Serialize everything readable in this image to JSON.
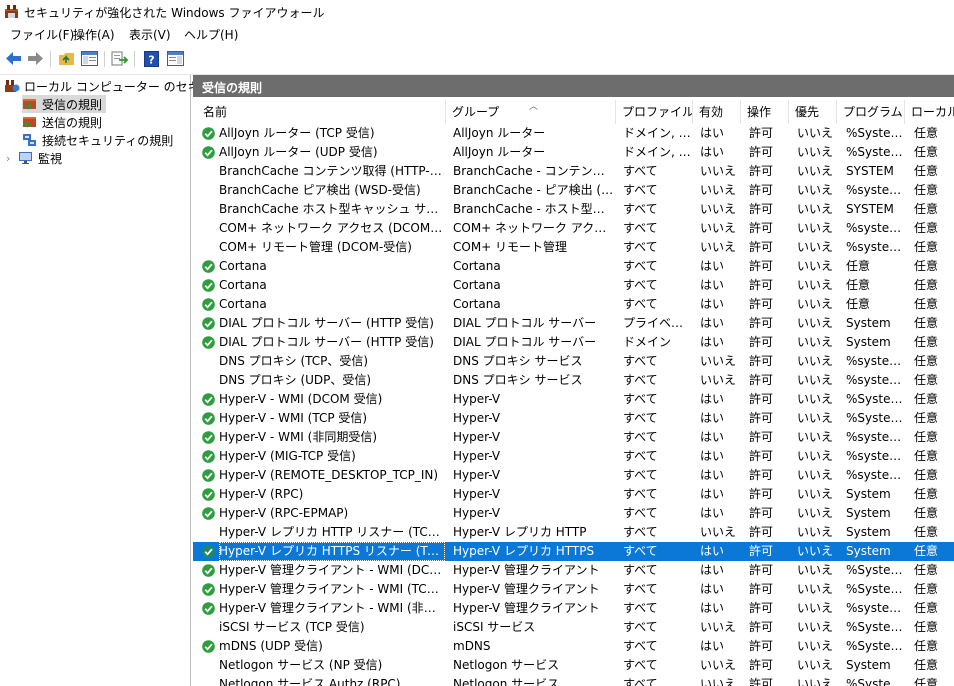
{
  "window": {
    "title": "セキュリティが強化された Windows ファイアウォール"
  },
  "menu": [
    "ファイル(F)",
    "操作(A)",
    "表示(V)",
    "ヘルプ(H)"
  ],
  "toolbar": {
    "buttons": [
      "back-icon",
      "forward-icon",
      "up-folder-icon",
      "show-hide-tree-icon",
      "export-list-icon",
      "help-icon",
      "show-hide-action-pane-icon"
    ]
  },
  "tree": {
    "root": "ローカル コンピューター のセキュリティ",
    "items": [
      "受信の規則",
      "送信の規則",
      "接続セキュリティの規則",
      "監視"
    ]
  },
  "panel": {
    "title": "受信の規則"
  },
  "columns": [
    "名前",
    "グループ",
    "プロファイル",
    "有効",
    "操作",
    "優先",
    "プログラム",
    "ローカル"
  ],
  "rules": [
    {
      "name": "AllJoyn ルーター (TCP 受信)",
      "group": "AllJoyn ルーター",
      "profile": "ドメイン, プ...",
      "enabled": "はい",
      "action": "許可",
      "override": "いいえ",
      "program": "%System...",
      "local": "任意",
      "on": true
    },
    {
      "name": "AllJoyn ルーター (UDP 受信)",
      "group": "AllJoyn ルーター",
      "profile": "ドメイン, プ...",
      "enabled": "はい",
      "action": "許可",
      "override": "いいえ",
      "program": "%System...",
      "local": "任意",
      "on": true
    },
    {
      "name": "BranchCache コンテンツ取得 (HTTP-受信)",
      "group": "BranchCache - コンテンツ取得...",
      "profile": "すべて",
      "enabled": "いいえ",
      "action": "許可",
      "override": "いいえ",
      "program": "SYSTEM",
      "local": "任意",
      "on": false
    },
    {
      "name": "BranchCache ピア検出 (WSD-受信)",
      "group": "BranchCache - ピア検出 (WS...",
      "profile": "すべて",
      "enabled": "いいえ",
      "action": "許可",
      "override": "いいえ",
      "program": "%system...",
      "local": "任意",
      "on": false
    },
    {
      "name": "BranchCache ホスト型キャッシュ サーバー (HT...",
      "group": "BranchCache - ホスト型キャッ...",
      "profile": "すべて",
      "enabled": "いいえ",
      "action": "許可",
      "override": "いいえ",
      "program": "SYSTEM",
      "local": "任意",
      "on": false
    },
    {
      "name": "COM+ ネットワーク アクセス (DCOM-受信)",
      "group": "COM+ ネットワーク アクセス",
      "profile": "すべて",
      "enabled": "いいえ",
      "action": "許可",
      "override": "いいえ",
      "program": "%system...",
      "local": "任意",
      "on": false
    },
    {
      "name": "COM+ リモート管理 (DCOM-受信)",
      "group": "COM+ リモート管理",
      "profile": "すべて",
      "enabled": "いいえ",
      "action": "許可",
      "override": "いいえ",
      "program": "%system...",
      "local": "任意",
      "on": false
    },
    {
      "name": "Cortana",
      "group": "Cortana",
      "profile": "すべて",
      "enabled": "はい",
      "action": "許可",
      "override": "いいえ",
      "program": "任意",
      "local": "任意",
      "on": true
    },
    {
      "name": "Cortana",
      "group": "Cortana",
      "profile": "すべて",
      "enabled": "はい",
      "action": "許可",
      "override": "いいえ",
      "program": "任意",
      "local": "任意",
      "on": true
    },
    {
      "name": "Cortana",
      "group": "Cortana",
      "profile": "すべて",
      "enabled": "はい",
      "action": "許可",
      "override": "いいえ",
      "program": "任意",
      "local": "任意",
      "on": true
    },
    {
      "name": "DIAL プロトコル サーバー (HTTP 受信)",
      "group": "DIAL プロトコル サーバー",
      "profile": "プライベート",
      "enabled": "はい",
      "action": "許可",
      "override": "いいえ",
      "program": "System",
      "local": "任意",
      "on": true
    },
    {
      "name": "DIAL プロトコル サーバー (HTTP 受信)",
      "group": "DIAL プロトコル サーバー",
      "profile": "ドメイン",
      "enabled": "はい",
      "action": "許可",
      "override": "いいえ",
      "program": "System",
      "local": "任意",
      "on": true
    },
    {
      "name": "DNS プロキシ (TCP、受信)",
      "group": "DNS プロキシ サービス",
      "profile": "すべて",
      "enabled": "いいえ",
      "action": "許可",
      "override": "いいえ",
      "program": "%system...",
      "local": "任意",
      "on": false
    },
    {
      "name": "DNS プロキシ (UDP、受信)",
      "group": "DNS プロキシ サービス",
      "profile": "すべて",
      "enabled": "いいえ",
      "action": "許可",
      "override": "いいえ",
      "program": "%system...",
      "local": "任意",
      "on": false
    },
    {
      "name": "Hyper-V - WMI (DCOM 受信)",
      "group": "Hyper-V",
      "profile": "すべて",
      "enabled": "はい",
      "action": "許可",
      "override": "いいえ",
      "program": "%System...",
      "local": "任意",
      "on": true
    },
    {
      "name": "Hyper-V - WMI (TCP 受信)",
      "group": "Hyper-V",
      "profile": "すべて",
      "enabled": "はい",
      "action": "許可",
      "override": "いいえ",
      "program": "%System...",
      "local": "任意",
      "on": true
    },
    {
      "name": "Hyper-V - WMI (非同期受信)",
      "group": "Hyper-V",
      "profile": "すべて",
      "enabled": "はい",
      "action": "許可",
      "override": "いいえ",
      "program": "%system...",
      "local": "任意",
      "on": true
    },
    {
      "name": "Hyper-V (MIG-TCP 受信)",
      "group": "Hyper-V",
      "profile": "すべて",
      "enabled": "はい",
      "action": "許可",
      "override": "いいえ",
      "program": "%system...",
      "local": "任意",
      "on": true
    },
    {
      "name": "Hyper-V (REMOTE_DESKTOP_TCP_IN)",
      "group": "Hyper-V",
      "profile": "すべて",
      "enabled": "はい",
      "action": "許可",
      "override": "いいえ",
      "program": "%system...",
      "local": "任意",
      "on": true
    },
    {
      "name": "Hyper-V (RPC)",
      "group": "Hyper-V",
      "profile": "すべて",
      "enabled": "はい",
      "action": "許可",
      "override": "いいえ",
      "program": "System",
      "local": "任意",
      "on": true
    },
    {
      "name": "Hyper-V (RPC-EPMAP)",
      "group": "Hyper-V",
      "profile": "すべて",
      "enabled": "はい",
      "action": "許可",
      "override": "いいえ",
      "program": "System",
      "local": "任意",
      "on": true
    },
    {
      "name": "Hyper-V レプリカ HTTP リスナー (TCP 受信)",
      "group": "Hyper-V レプリカ HTTP",
      "profile": "すべて",
      "enabled": "いいえ",
      "action": "許可",
      "override": "いいえ",
      "program": "System",
      "local": "任意",
      "on": false
    },
    {
      "name": "Hyper-V レプリカ HTTPS リスナー (TCP 受信)",
      "group": "Hyper-V レプリカ HTTPS",
      "profile": "すべて",
      "enabled": "はい",
      "action": "許可",
      "override": "いいえ",
      "program": "System",
      "local": "任意",
      "on": true,
      "selected": true
    },
    {
      "name": "Hyper-V 管理クライアント - WMI (DCOM 受...",
      "group": "Hyper-V 管理クライアント",
      "profile": "すべて",
      "enabled": "はい",
      "action": "許可",
      "override": "いいえ",
      "program": "%System...",
      "local": "任意",
      "on": true
    },
    {
      "name": "Hyper-V 管理クライアント - WMI (TCP 受信)",
      "group": "Hyper-V 管理クライアント",
      "profile": "すべて",
      "enabled": "はい",
      "action": "許可",
      "override": "いいえ",
      "program": "%System...",
      "local": "任意",
      "on": true
    },
    {
      "name": "Hyper-V 管理クライアント - WMI (非同期 - ...",
      "group": "Hyper-V 管理クライアント",
      "profile": "すべて",
      "enabled": "はい",
      "action": "許可",
      "override": "いいえ",
      "program": "%system...",
      "local": "任意",
      "on": true
    },
    {
      "name": "iSCSI サービス (TCP 受信)",
      "group": "iSCSI サービス",
      "profile": "すべて",
      "enabled": "いいえ",
      "action": "許可",
      "override": "いいえ",
      "program": "%System...",
      "local": "任意",
      "on": false
    },
    {
      "name": "mDNS (UDP 受信)",
      "group": "mDNS",
      "profile": "すべて",
      "enabled": "はい",
      "action": "許可",
      "override": "いいえ",
      "program": "%System...",
      "local": "任意",
      "on": true
    },
    {
      "name": "Netlogon サービス (NP 受信)",
      "group": "Netlogon サービス",
      "profile": "すべて",
      "enabled": "いいえ",
      "action": "許可",
      "override": "いいえ",
      "program": "System",
      "local": "任意",
      "on": false
    },
    {
      "name": "Netlogon サービス Authz (RPC)",
      "group": "Netlogon サービス",
      "profile": "すべて",
      "enabled": "いいえ",
      "action": "許可",
      "override": "いいえ",
      "program": "%System...",
      "local": "任意",
      "on": false
    }
  ],
  "colors": {
    "selection": "#0b78d7",
    "header": "#6d6d6d",
    "check": "#2e9e3f"
  }
}
